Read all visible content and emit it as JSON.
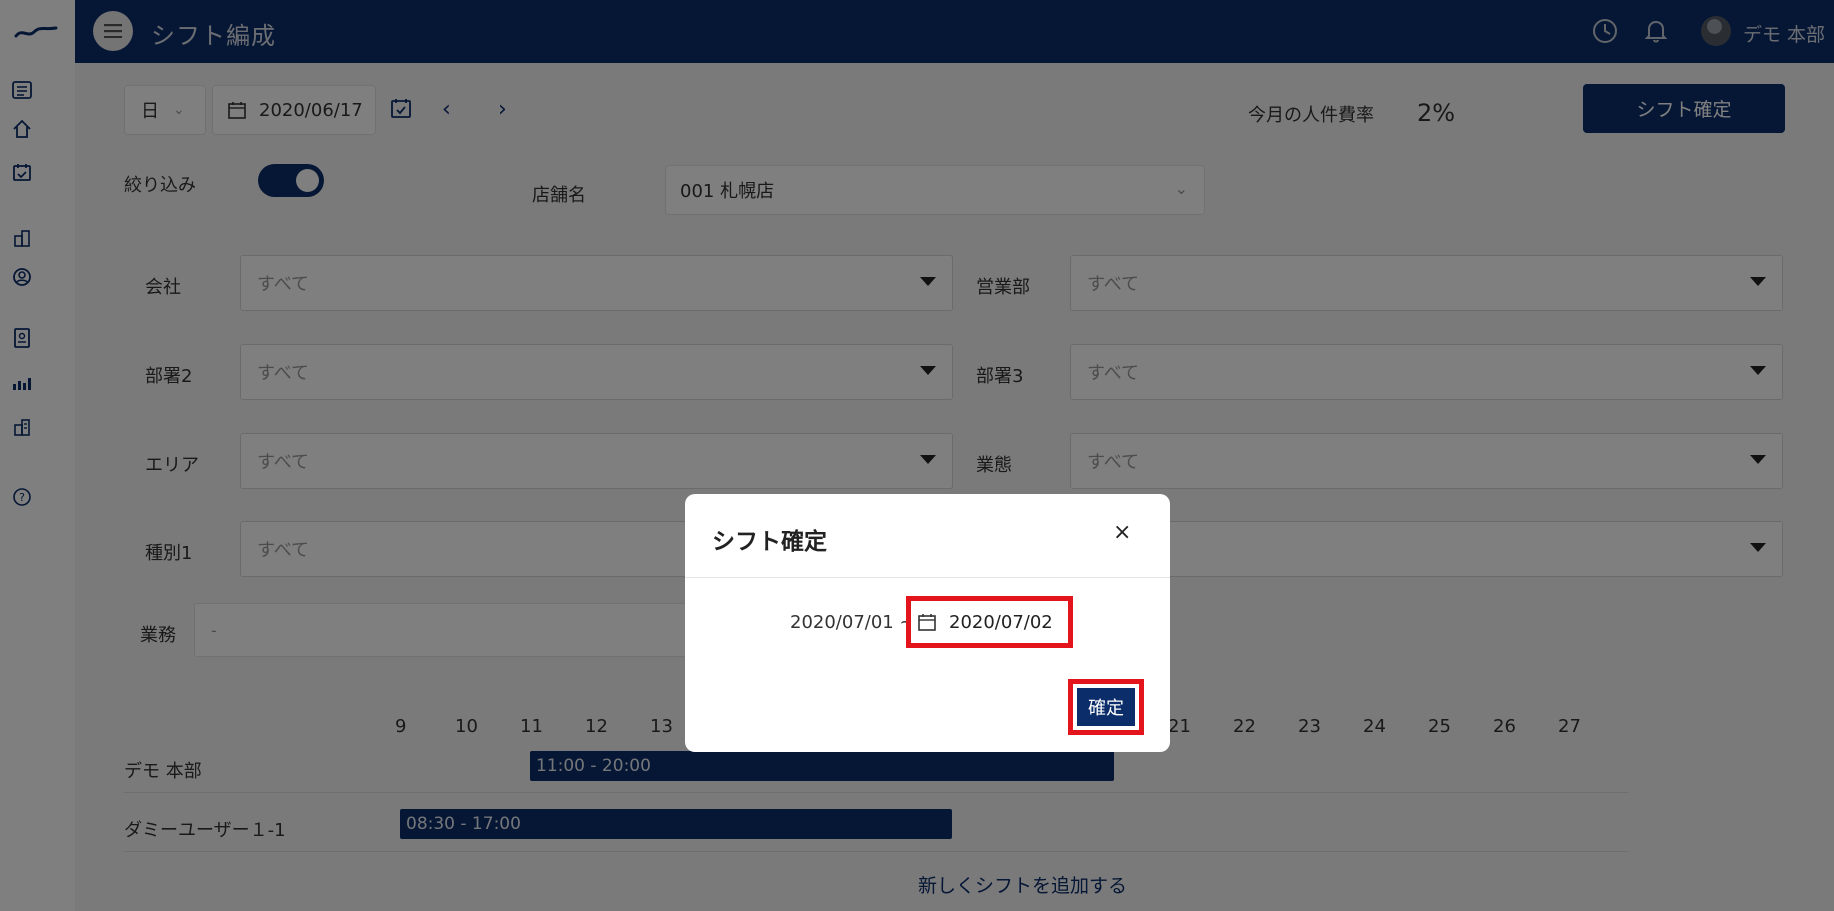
{
  "topbar": {
    "title": "シフト編成",
    "user_name": "デモ 本部"
  },
  "toolbar": {
    "view_mode": "日",
    "date": "2020/06/17",
    "labor_cost_label": "今月の人件費率",
    "labor_cost_value": "2%",
    "confirm_button": "シフト確定"
  },
  "filters": {
    "toggle_label": "絞り込み",
    "toggle_on": true,
    "store_label": "店舗名",
    "store_value": "001 札幌店",
    "fields": [
      {
        "label": "会社",
        "value": "すべて"
      },
      {
        "label": "営業部",
        "value": "すべて"
      },
      {
        "label": "部署2",
        "value": "すべて"
      },
      {
        "label": "部署3",
        "value": "すべて"
      },
      {
        "label": "エリア",
        "value": "すべて"
      },
      {
        "label": "業態",
        "value": "すべて"
      },
      {
        "label": "種別1",
        "value": "すべて"
      },
      {
        "label": "",
        "value": ""
      }
    ],
    "business_label": "業務",
    "business_value": "-"
  },
  "timeline": {
    "hours": [
      "9",
      "10",
      "11",
      "12",
      "13",
      "21",
      "22",
      "23",
      "24",
      "25",
      "26",
      "27"
    ],
    "rows": [
      {
        "name": "デモ 本部",
        "shift": "11:00 - 20:00"
      },
      {
        "name": "ダミーユーザー１-1",
        "shift": "08:30 - 17:00"
      }
    ],
    "add_shift": "新しくシフトを追加する"
  },
  "modal": {
    "title": "シフト確定",
    "close": "×",
    "range_start": "2020/07/01 ~",
    "range_end": "2020/07/02",
    "confirm": "確定"
  },
  "colors": {
    "primary": "#0b2e6b",
    "highlight": "#e3141c"
  }
}
